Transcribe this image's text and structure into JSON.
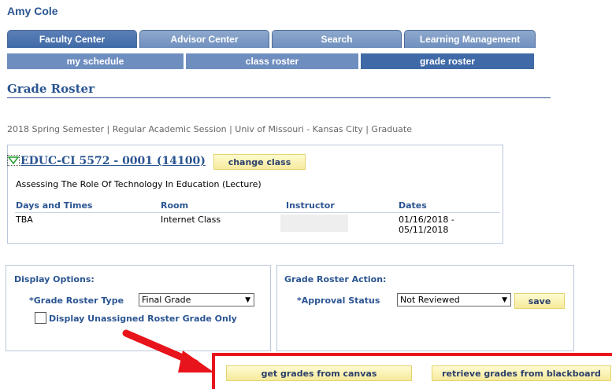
{
  "user": {
    "name": "Amy Cole"
  },
  "tabs": [
    "Faculty Center",
    "Advisor Center",
    "Search",
    "Learning Management"
  ],
  "subtabs": [
    "my schedule",
    "class roster",
    "grade roster"
  ],
  "page": {
    "title": "Grade Roster"
  },
  "session": "2018 Spring Semester | Regular Academic Session | Univ of Missouri - Kansas City | Graduate",
  "class_info": {
    "code": "EDUC-CI 5572 - 0001 (14100)",
    "change_label": "change class",
    "description": "Assessing The Role Of Technology In Education (Lecture)",
    "headers": [
      "Days and Times",
      "Room",
      "Instructor",
      "Dates"
    ],
    "row": {
      "days": "TBA",
      "room": "Internet Class",
      "instructor": "",
      "dates_line1": "01/16/2018 -",
      "dates_line2": "05/11/2018"
    }
  },
  "display_options": {
    "title": "Display Options:",
    "type_label": "*Grade Roster Type",
    "type_value": "Final Grade",
    "unassigned_label": "Display Unassigned Roster Grade Only",
    "unassigned_checked": false
  },
  "roster_action": {
    "title": "Grade Roster Action:",
    "approval_label": "*Approval Status",
    "approval_value": "Not Reviewed",
    "save_label": "save"
  },
  "buttons": {
    "canvas": "get grades from canvas",
    "blackboard": "retrieve grades from blackboard"
  },
  "colors": {
    "accent": "#2b5592",
    "tab": "#6f8ec0",
    "tab_active": "#3f6aa7",
    "button": "#f5ea9c",
    "highlight": "#e8141b"
  }
}
